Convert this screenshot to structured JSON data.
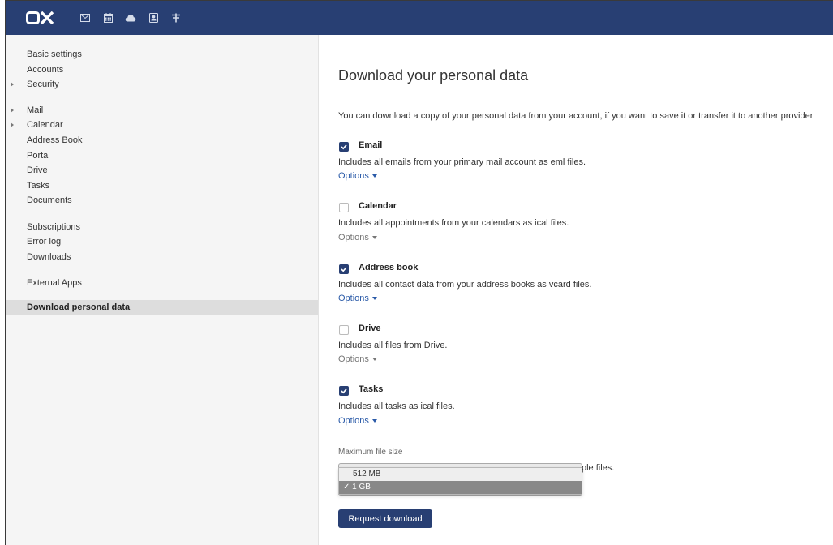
{
  "topbar": {
    "logo_text": "OX",
    "icons": [
      "mail-icon",
      "calendar-icon",
      "cloud-icon",
      "address-book-icon",
      "portal-icon"
    ]
  },
  "sidebar": {
    "items": [
      {
        "label": "Basic settings",
        "caret": false
      },
      {
        "label": "Accounts",
        "caret": false
      },
      {
        "label": "Security",
        "caret": true
      },
      {
        "label": "Mail",
        "caret": true
      },
      {
        "label": "Calendar",
        "caret": true
      },
      {
        "label": "Address Book",
        "caret": false
      },
      {
        "label": "Portal",
        "caret": false
      },
      {
        "label": "Drive",
        "caret": false
      },
      {
        "label": "Tasks",
        "caret": false
      },
      {
        "label": "Documents",
        "caret": false
      },
      {
        "label": "Subscriptions",
        "caret": false
      },
      {
        "label": "Error log",
        "caret": false
      },
      {
        "label": "Downloads",
        "caret": false
      },
      {
        "label": "External Apps",
        "caret": false
      },
      {
        "label": "Download personal data",
        "caret": false,
        "selected": true
      }
    ]
  },
  "main": {
    "title": "Download your personal data",
    "intro": "You can download a copy of your personal data from your account, if you want to save it or transfer it to another provider",
    "sections": [
      {
        "name": "Email",
        "checked": true,
        "description": "Includes all emails from your primary mail account as eml files.",
        "options_label": "Options"
      },
      {
        "name": "Calendar",
        "checked": false,
        "description": "Includes all appointments from your calendars as ical files.",
        "options_label": "Options"
      },
      {
        "name": "Address book",
        "checked": true,
        "description": "Includes all contact data from your address books as vcard files.",
        "options_label": "Options"
      },
      {
        "name": "Drive",
        "checked": false,
        "description": "Includes all files from Drive.",
        "options_label": "Options"
      },
      {
        "name": "Tasks",
        "checked": true,
        "description": "Includes all tasks as ical files.",
        "options_label": "Options"
      }
    ],
    "max_size": {
      "label": "Maximum file size",
      "help_text": "ple files.",
      "options": [
        "512 MB",
        "1 GB"
      ],
      "selected_marker": "✓ ",
      "selected_index": 1
    },
    "request_button": "Request download"
  },
  "colors": {
    "brand": "#283f73",
    "link": "#2a5aa8",
    "sidebar_bg": "#f5f5f5",
    "selected_bg": "#dddddd"
  }
}
